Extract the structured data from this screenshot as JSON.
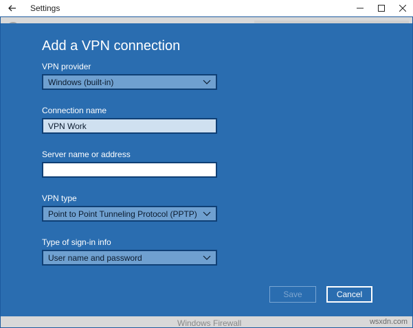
{
  "window": {
    "app_title": "Settings",
    "back_icon": "back-arrow-icon",
    "controls": [
      "minimize-icon",
      "maximize-icon",
      "close-icon"
    ]
  },
  "background": {
    "bottom_item": "Windows Firewall"
  },
  "dialog": {
    "title": "Add a VPN connection",
    "vpn_provider": {
      "label": "VPN provider",
      "value": "Windows (built-in)"
    },
    "connection_name": {
      "label": "Connection name",
      "value": "VPN Work"
    },
    "server": {
      "label": "Server name or address",
      "value": ""
    },
    "vpn_type": {
      "label": "VPN type",
      "value": "Point to Point Tunneling Protocol (PPTP)"
    },
    "sign_in": {
      "label": "Type of sign-in info",
      "value": "User name and password"
    },
    "save_label": "Save",
    "cancel_label": "Cancel"
  },
  "watermark": "wsxdn.com",
  "colors": {
    "dialog_bg": "#2a6db0",
    "field_border": "#0f3f75",
    "select_bg": "#6fa0d0"
  }
}
